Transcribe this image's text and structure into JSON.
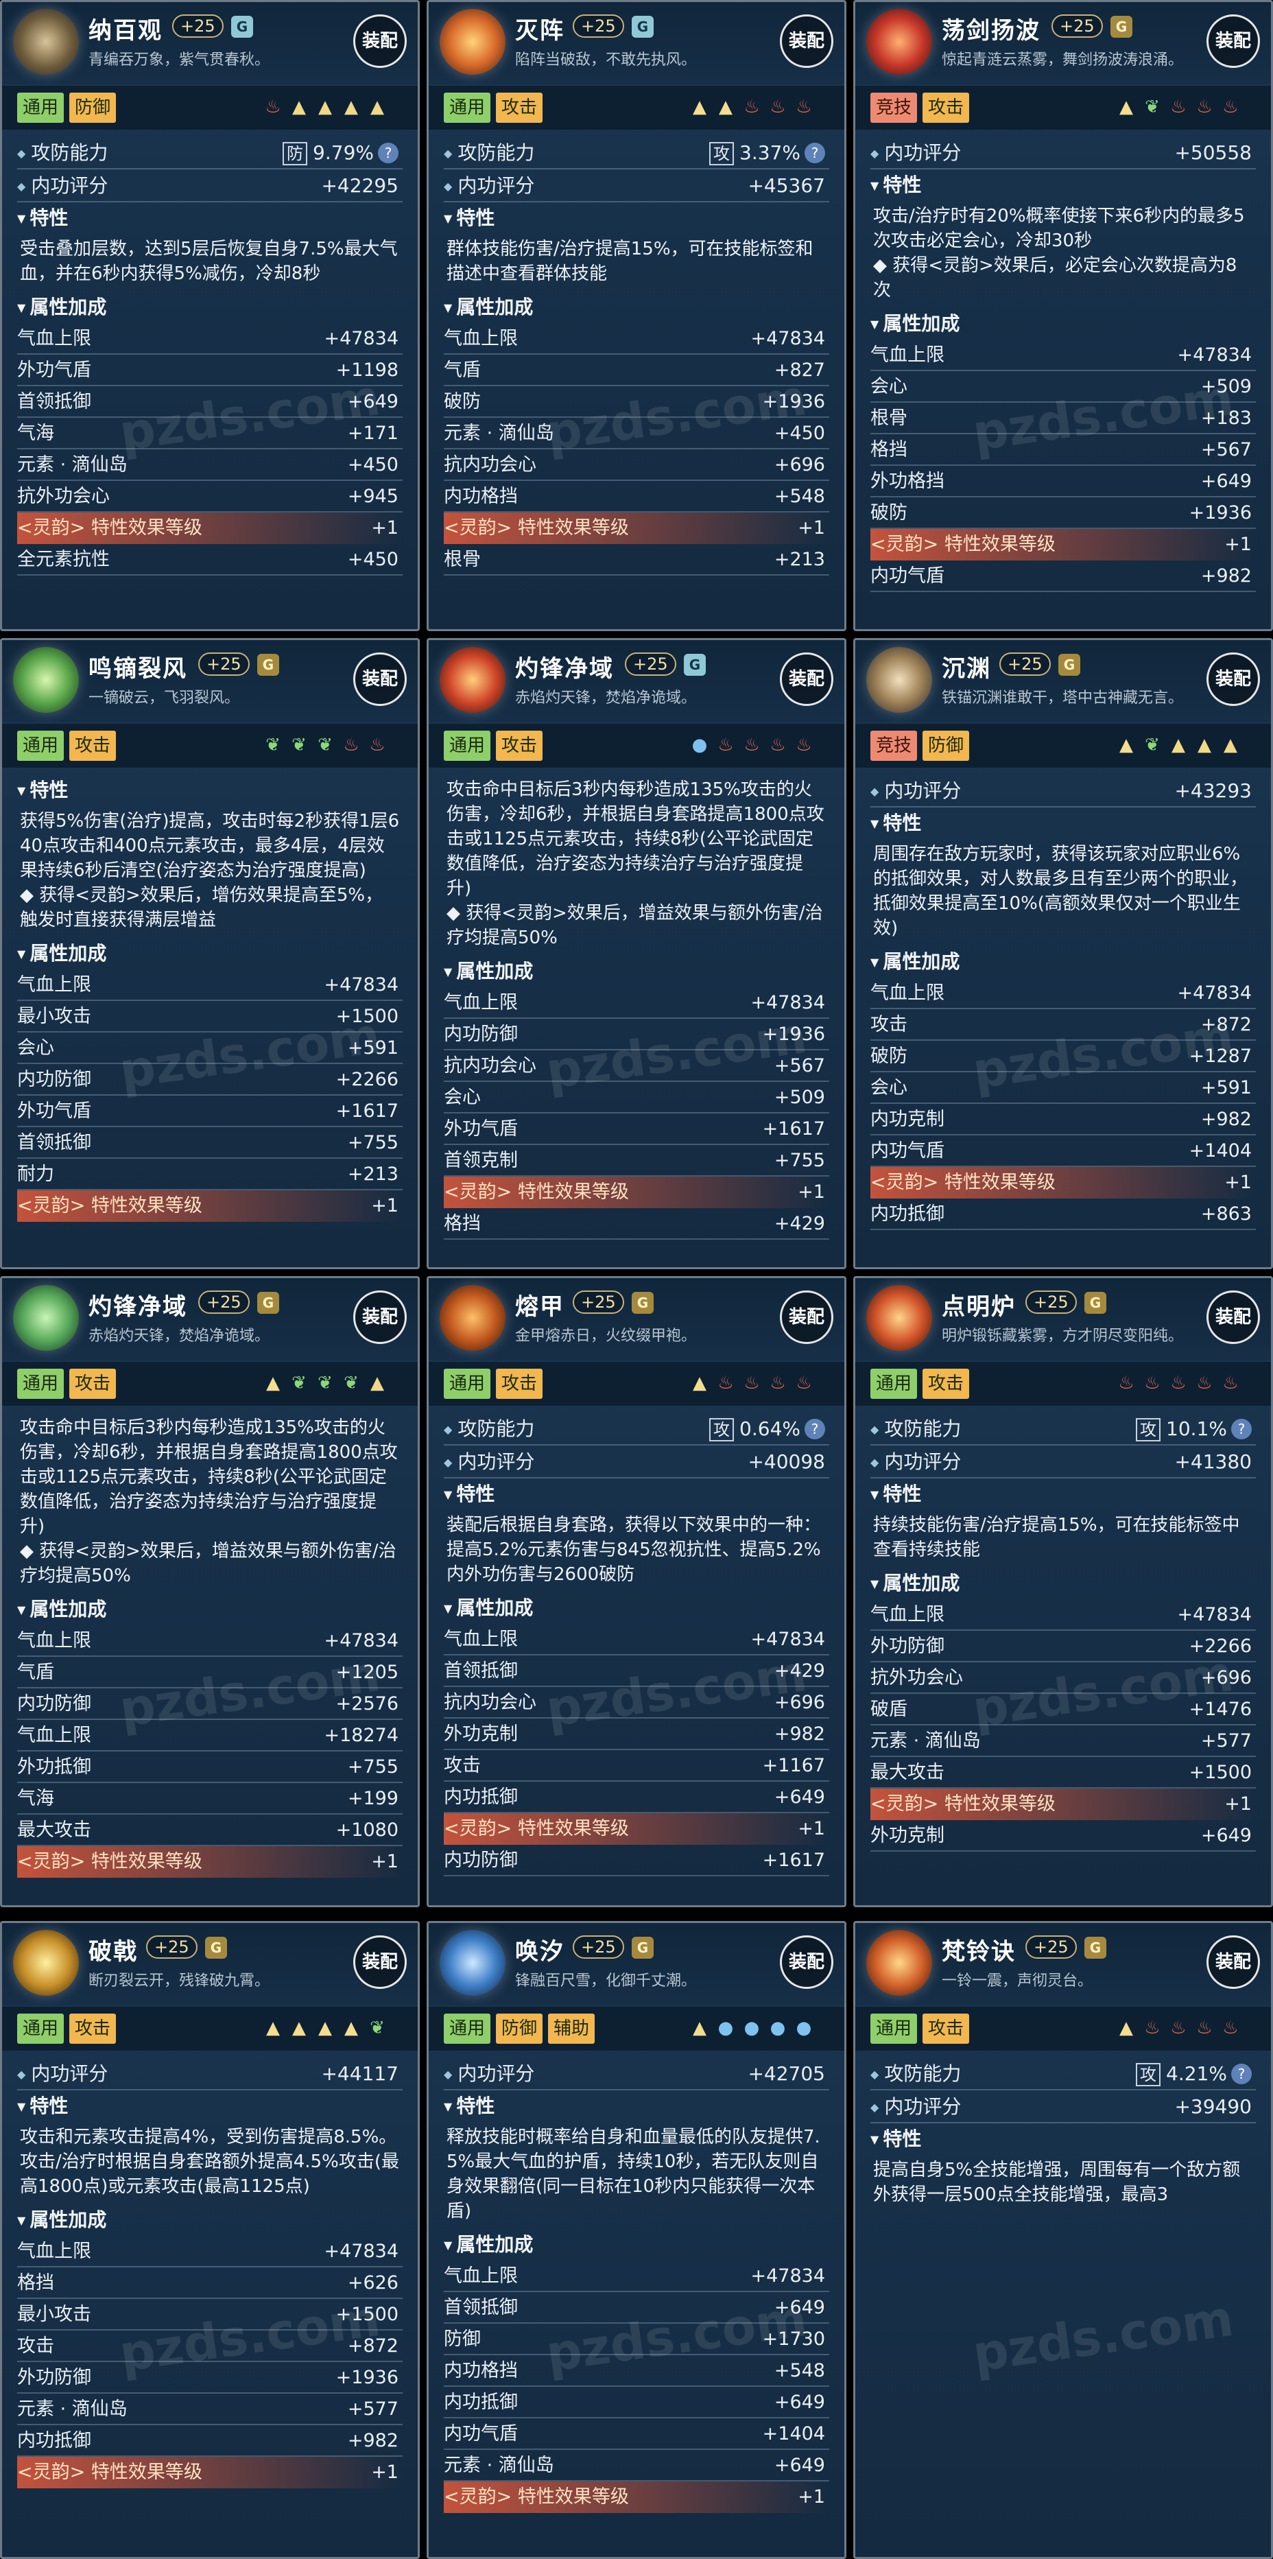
{
  "equip_label": "装配",
  "watermark": "pzds.com",
  "cards": [
    {
      "name": "纳百观",
      "level": "+25",
      "rank": "G",
      "rank_kind": "g",
      "motto": "青编吞万象，紫气贯春秋。",
      "tags": [
        "通用",
        "防御"
      ],
      "tag_red": false,
      "symbols": [
        "fire",
        "trap",
        "trap",
        "trap",
        "trap"
      ],
      "stats": [
        {
          "label": "攻防能力",
          "box": "防",
          "value": "9.79%",
          "q": "?"
        },
        {
          "label": "内功评分",
          "value": "+42295"
        }
      ],
      "trait_title": "特性",
      "trait": "受击叠加层数，达到5层后恢复自身7.5%最大气血，并在6秒内获得5%减伤，冷却8秒",
      "attr_title": "属性加成",
      "attrs": [
        [
          "气血上限",
          "+47834"
        ],
        [
          "外功气盾",
          "+1198"
        ],
        [
          "首领抵御",
          "+649"
        ],
        [
          "气海",
          "+171"
        ],
        [
          "元素 · 滴仙岛",
          "+450"
        ],
        [
          "抗外功会心",
          "+945"
        ],
        [
          "<灵韵> 特性效果等级",
          "+1",
          true
        ],
        [
          "全元素抗性",
          "+450"
        ]
      ]
    },
    {
      "name": "灭阵",
      "level": "+25",
      "rank": "G",
      "rank_kind": "g",
      "motto": "陷阵当破敌，不敢先执风。",
      "tags": [
        "通用",
        "攻击"
      ],
      "tag_red": false,
      "symbols": [
        "tri",
        "tri",
        "fire",
        "fire",
        "fire"
      ],
      "stats": [
        {
          "label": "攻防能力",
          "box": "攻",
          "value": "3.37%",
          "q": "?"
        },
        {
          "label": "内功评分",
          "value": "+45367"
        }
      ],
      "trait_title": "特性",
      "trait": "群体技能伤害/治疗提高15%，可在技能标签和描述中查看群体技能",
      "attr_title": "属性加成",
      "attrs": [
        [
          "气血上限",
          "+47834"
        ],
        [
          "气盾",
          "+827"
        ],
        [
          "破防",
          "+1936"
        ],
        [
          "元素 · 滴仙岛",
          "+450"
        ],
        [
          "抗内功会心",
          "+696"
        ],
        [
          "内功格挡",
          "+548"
        ],
        [
          "<灵韵> 特性效果等级",
          "+1",
          true
        ],
        [
          "根骨",
          "+213"
        ]
      ]
    },
    {
      "name": "荡剑扬波",
      "level": "+25",
      "rank": "G",
      "rank_kind": "y",
      "motto": "惊起青涟云蒸雾，舞剑扬波涛浪涌。",
      "tags": [
        "竞技",
        "攻击"
      ],
      "tag_red": true,
      "symbols": [
        "tri",
        "leaf",
        "fire",
        "fire",
        "fire"
      ],
      "stats": [
        {
          "label": "内功评分",
          "value": "+50558"
        }
      ],
      "trait_title": "特性",
      "trait": "攻击/治疗时有20%概率使接下来6秒内的最多5次攻击必定会心，冷却30秒\n◆ 获得<灵韵>效果后，必定会心次数提高为8次",
      "attr_title": "属性加成",
      "attrs": [
        [
          "气血上限",
          "+47834"
        ],
        [
          "会心",
          "+509"
        ],
        [
          "根骨",
          "+183"
        ],
        [
          "格挡",
          "+567"
        ],
        [
          "外功格挡",
          "+649"
        ],
        [
          "破防",
          "+1936"
        ],
        [
          "<灵韵> 特性效果等级",
          "+1",
          true
        ],
        [
          "内功气盾",
          "+982"
        ]
      ]
    },
    {
      "name": "鸣镝裂风",
      "level": "+25",
      "rank": "G",
      "rank_kind": "y",
      "motto": "一镝破云，飞羽裂风。",
      "tags": [
        "通用",
        "攻击"
      ],
      "tag_red": false,
      "symbols": [
        "leaf",
        "leaf",
        "leaf",
        "fire",
        "fire"
      ],
      "stats": [],
      "trait_title": "特性",
      "trait": "获得5%伤害(治疗)提高，攻击时每2秒获得1层640点攻击和400点元素攻击，最多4层，4层效果持续6秒后清空(治疗姿态为治疗强度提高)\n◆ 获得<灵韵>效果后，增伤效果提高至5%，触发时直接获得满层增益",
      "attr_title": "属性加成",
      "attrs": [
        [
          "气血上限",
          "+47834"
        ],
        [
          "最小攻击",
          "+1500"
        ],
        [
          "会心",
          "+591"
        ],
        [
          "内功防御",
          "+2266"
        ],
        [
          "外功气盾",
          "+1617"
        ],
        [
          "首领抵御",
          "+755"
        ],
        [
          "耐力",
          "+213"
        ],
        [
          "<灵韵> 特性效果等级",
          "+1",
          true
        ]
      ]
    },
    {
      "name": "灼锋净域",
      "level": "+25",
      "rank": "G",
      "rank_kind": "g",
      "motto": "赤焰灼天锋，焚焰净诡域。",
      "tags": [
        "通用",
        "攻击"
      ],
      "tag_red": false,
      "symbols": [
        "drop",
        "fire",
        "fire",
        "fire",
        "fire"
      ],
      "stats": [],
      "trait_title": "",
      "trait": "攻击命中目标后3秒内每秒造成135%攻击的火伤害，冷却6秒，并根据自身套路提高1800点攻击或1125点元素攻击，持续8秒(公平论武固定数值降低，治疗姿态为持续治疗与治疗强度提升)\n◆ 获得<灵韵>效果后，增益效果与额外伤害/治疗均提高50%",
      "attr_title": "属性加成",
      "attrs": [
        [
          "气血上限",
          "+47834"
        ],
        [
          "内功防御",
          "+1936"
        ],
        [
          "抗内功会心",
          "+567"
        ],
        [
          "会心",
          "+509"
        ],
        [
          "外功气盾",
          "+1617"
        ],
        [
          "首领克制",
          "+755"
        ],
        [
          "<灵韵> 特性效果等级",
          "+1",
          true
        ],
        [
          "格挡",
          "+429"
        ]
      ]
    },
    {
      "name": "沉渊",
      "level": "+25",
      "rank": "G",
      "rank_kind": "y",
      "motto": "铁锚沉渊谁敢干，塔中古神藏无言。",
      "tags": [
        "竞技",
        "防御"
      ],
      "tag_red": true,
      "symbols": [
        "tri",
        "leaf",
        "trap",
        "trap",
        "trap"
      ],
      "stats": [
        {
          "label": "内功评分",
          "value": "+43293"
        }
      ],
      "trait_title": "特性",
      "trait": "周围存在敌方玩家时，获得该玩家对应职业6%的抵御效果，对人数最多且有至少两个的职业，抵御效果提高至10%(高额效果仅对一个职业生效)",
      "attr_title": "属性加成",
      "attrs": [
        [
          "气血上限",
          "+47834"
        ],
        [
          "攻击",
          "+872"
        ],
        [
          "破防",
          "+1287"
        ],
        [
          "会心",
          "+591"
        ],
        [
          "内功克制",
          "+982"
        ],
        [
          "内功气盾",
          "+1404"
        ],
        [
          "<灵韵> 特性效果等级",
          "+1",
          true
        ],
        [
          "内功抵御",
          "+863"
        ]
      ]
    },
    {
      "name": "灼锋净域",
      "level": "+25",
      "rank": "G",
      "rank_kind": "y",
      "motto": "赤焰灼天锋，焚焰净诡域。",
      "tags": [
        "通用",
        "攻击"
      ],
      "tag_red": false,
      "symbols": [
        "tri",
        "leaf",
        "leaf",
        "leaf",
        "trap"
      ],
      "stats": [],
      "trait_title": "",
      "trait": "攻击命中目标后3秒内每秒造成135%攻击的火伤害，冷却6秒，并根据自身套路提高1800点攻击或1125点元素攻击，持续8秒(公平论武固定数值降低，治疗姿态为持续治疗与治疗强度提升)\n◆ 获得<灵韵>效果后，增益效果与额外伤害/治疗均提高50%",
      "attr_title": "属性加成",
      "attrs": [
        [
          "气血上限",
          "+47834"
        ],
        [
          "气盾",
          "+1205"
        ],
        [
          "内功防御",
          "+2576"
        ],
        [
          "气血上限",
          "+18274"
        ],
        [
          "外功抵御",
          "+755"
        ],
        [
          "气海",
          "+199"
        ],
        [
          "最大攻击",
          "+1080"
        ],
        [
          "<灵韵> 特性效果等级",
          "+1",
          true
        ]
      ]
    },
    {
      "name": "熔甲",
      "level": "+25",
      "rank": "G",
      "rank_kind": "y",
      "motto": "金甲熔赤日，火纹缀甲袍。",
      "tags": [
        "通用",
        "攻击"
      ],
      "tag_red": false,
      "symbols": [
        "tri",
        "fire",
        "fire",
        "fire",
        "fire"
      ],
      "stats": [
        {
          "label": "攻防能力",
          "box": "攻",
          "value": "0.64%",
          "q": "?"
        },
        {
          "label": "内功评分",
          "value": "+40098"
        }
      ],
      "trait_title": "特性",
      "trait": "装配后根据自身套路，获得以下效果中的一种：提高5.2%元素伤害与845忽视抗性、提高5.2%内外功伤害与2600破防",
      "attr_title": "属性加成",
      "attrs": [
        [
          "气血上限",
          "+47834"
        ],
        [
          "首领抵御",
          "+429"
        ],
        [
          "抗内功会心",
          "+696"
        ],
        [
          "外功克制",
          "+982"
        ],
        [
          "攻击",
          "+1167"
        ],
        [
          "内功抵御",
          "+649"
        ],
        [
          "<灵韵> 特性效果等级",
          "+1",
          true
        ],
        [
          "内功防御",
          "+1617"
        ]
      ]
    },
    {
      "name": "点明炉",
      "level": "+25",
      "rank": "G",
      "rank_kind": "y",
      "motto": "明炉锻铄藏紫雾，方才阴尽变阳纯。",
      "tags": [
        "通用",
        "攻击"
      ],
      "tag_red": false,
      "symbols": [
        "fire",
        "fire",
        "fire",
        "fire",
        "fire"
      ],
      "stats": [
        {
          "label": "攻防能力",
          "box": "攻",
          "value": "10.1%",
          "q": "?"
        },
        {
          "label": "内功评分",
          "value": "+41380"
        }
      ],
      "trait_title": "特性",
      "trait": "持续技能伤害/治疗提高15%，可在技能标签中查看持续技能",
      "attr_title": "属性加成",
      "attrs": [
        [
          "气血上限",
          "+47834"
        ],
        [
          "外功防御",
          "+2266"
        ],
        [
          "抗外功会心",
          "+696"
        ],
        [
          "破盾",
          "+1476"
        ],
        [
          "元素 · 滴仙岛",
          "+577"
        ],
        [
          "最大攻击",
          "+1500"
        ],
        [
          "<灵韵> 特性效果等级",
          "+1",
          true
        ],
        [
          "外功克制",
          "+649"
        ]
      ]
    },
    {
      "name": "破戟",
      "level": "+25",
      "rank": "G",
      "rank_kind": "y",
      "motto": "断刃裂云开，残锋破九霄。",
      "tags": [
        "通用",
        "攻击"
      ],
      "tag_red": false,
      "symbols": [
        "tri",
        "tri",
        "tri",
        "tri",
        "leaf"
      ],
      "stats": [
        {
          "label": "内功评分",
          "value": "+44117"
        }
      ],
      "trait_title": "特性",
      "trait": "攻击和元素攻击提高4%，受到伤害提高8.5%。攻击/治疗时根据自身套路额外提高4.5%攻击(最高1800点)或元素攻击(最高1125点)",
      "attr_title": "属性加成",
      "attrs": [
        [
          "气血上限",
          "+47834"
        ],
        [
          "格挡",
          "+626"
        ],
        [
          "最小攻击",
          "+1500"
        ],
        [
          "攻击",
          "+872"
        ],
        [
          "外功防御",
          "+1936"
        ],
        [
          "元素 · 滴仙岛",
          "+577"
        ],
        [
          "内功抵御",
          "+982"
        ],
        [
          "<灵韵> 特性效果等级",
          "+1",
          true
        ]
      ]
    },
    {
      "name": "唤汐",
      "level": "+25",
      "rank": "G",
      "rank_kind": "y",
      "motto": "锋融百尺雪，化御千丈潮。",
      "tags": [
        "通用",
        "防御",
        "辅助"
      ],
      "tag_red": false,
      "symbols": [
        "tri",
        "drop",
        "drop",
        "drop",
        "drop"
      ],
      "stats": [
        {
          "label": "内功评分",
          "value": "+42705"
        }
      ],
      "trait_title": "特性",
      "trait": "释放技能时概率给自身和血量最低的队友提供7.5%最大气血的护盾，持续10秒，若无队友则自身效果翻倍(同一目标在10秒内只能获得一次本盾)",
      "attr_title": "属性加成",
      "attrs": [
        [
          "气血上限",
          "+47834"
        ],
        [
          "首领抵御",
          "+649"
        ],
        [
          "防御",
          "+1730"
        ],
        [
          "内功格挡",
          "+548"
        ],
        [
          "内功抵御",
          "+649"
        ],
        [
          "内功气盾",
          "+1404"
        ],
        [
          "元素 · 滴仙岛",
          "+649"
        ],
        [
          "<灵韵> 特性效果等级",
          "+1",
          true
        ]
      ]
    },
    {
      "name": "梵铃诀",
      "level": "+25",
      "rank": "G",
      "rank_kind": "y",
      "motto": "一铃一震，声彻灵台。",
      "tags": [
        "通用",
        "攻击"
      ],
      "tag_red": false,
      "symbols": [
        "tri",
        "fire",
        "fire",
        "fire",
        "fire"
      ],
      "stats": [
        {
          "label": "攻防能力",
          "box": "攻",
          "value": "4.21%",
          "q": "?"
        },
        {
          "label": "内功评分",
          "value": "+39490"
        }
      ],
      "trait_title": "特性",
      "trait": "提高自身5%全技能增强，周围每有一个敌方额外获得一层500点全技能增强，最高3",
      "attr_title": "",
      "attrs": []
    }
  ]
}
